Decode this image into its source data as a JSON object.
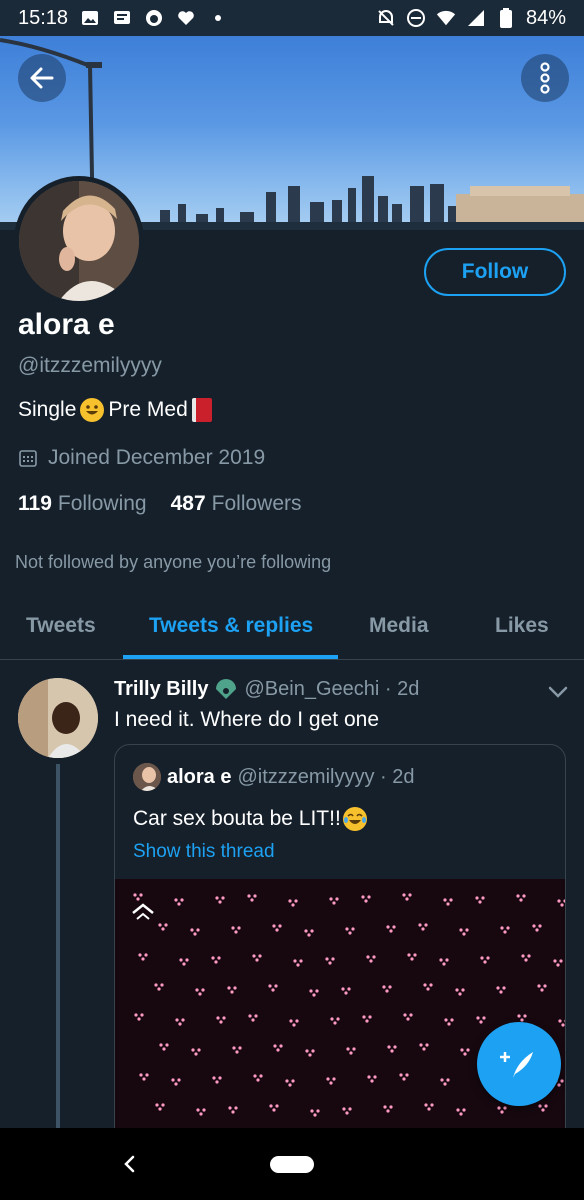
{
  "status_bar": {
    "time": "15:18",
    "battery": "84%"
  },
  "profile": {
    "name": "alora e",
    "handle": "@itzzzemilyyyy",
    "bio_text_1": "Single",
    "bio_text_2": " Pre Med",
    "joined": "Joined December 2019",
    "following_count": "119",
    "following_label": "Following",
    "followers_count": "487",
    "followers_label": "Followers",
    "not_followed": "Not followed by anyone you’re following",
    "follow_button": "Follow"
  },
  "tabs": [
    {
      "label": "Tweets",
      "active": false
    },
    {
      "label": "Tweets & replies",
      "active": true
    },
    {
      "label": "Media",
      "active": false
    },
    {
      "label": "Likes",
      "active": false
    }
  ],
  "tweet": {
    "name": "Trilly Billy",
    "handle": "@Bein_Geechi · 2d",
    "text": "I need it. Where do I get one",
    "quote": {
      "name": "alora e",
      "handle": "@itzzzemilyyyy · 2d",
      "text": "Car sex bouta be LIT!!",
      "link": "Show this thread"
    }
  },
  "colors": {
    "background": "#15202b",
    "accent": "#1da1f2",
    "secondary_text": "#8899a6",
    "border": "#38444d"
  },
  "icons": [
    "back-arrow-icon",
    "more-vertical-icon",
    "calendar-icon",
    "chevron-down-icon",
    "compose-tweet-icon",
    "gif-icon",
    "verified-peacock-icon"
  ]
}
